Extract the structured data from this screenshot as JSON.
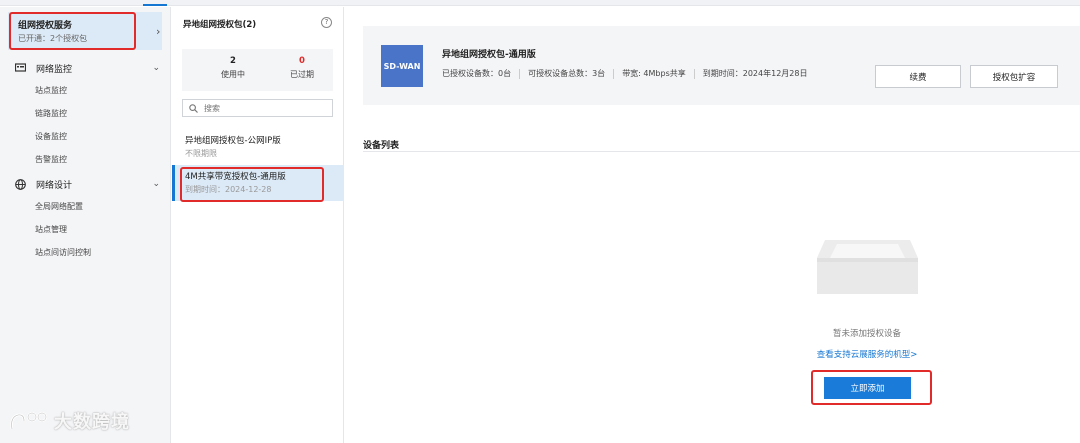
{
  "left_nav": {
    "service": {
      "title": "组网授权服务",
      "subtitle": "已开通：2个授权包",
      "arrow": "›"
    },
    "groups": [
      {
        "label": "网络监控",
        "icon": "monitor-icon",
        "items": [
          "站点监控",
          "链路监控",
          "设备监控",
          "告警监控"
        ]
      },
      {
        "label": "网络设计",
        "icon": "globe-icon",
        "items": [
          "全局网络配置",
          "站点管理",
          "站点间访问控制"
        ]
      }
    ]
  },
  "middle": {
    "title": "异地组网授权包(2)",
    "stats": [
      {
        "value": "2",
        "label": "使用中",
        "color": "#222222"
      },
      {
        "value": "0",
        "label": "已过期",
        "color": "#e12a2a"
      }
    ],
    "search": {
      "placeholder": "搜索"
    },
    "packages": [
      {
        "name": "异地组网授权包-公网IP版",
        "sub": "不限期限",
        "active": false
      },
      {
        "name": "4M共享带宽授权包-通用版",
        "sub": "到期时间：2024-12-28",
        "active": true
      }
    ]
  },
  "main": {
    "logo_text": "SD-WAN",
    "package_title": "异地组网授权包-通用版",
    "details": [
      "已授权设备数：0台",
      "可授权设备总数：3台",
      "带宽: 4Mbps共享",
      "到期时间：2024年12月28日"
    ],
    "renew_button": "续费",
    "expand_button": "授权包扩容",
    "section_title": "设备列表",
    "empty_text": "暂未添加授权设备",
    "empty_link": "查看支持云展服务的机型>",
    "add_button": "立即添加"
  },
  "watermark": "大数跨境",
  "colors": {
    "accent": "#1677d2",
    "highlight": "#e12a2a",
    "selected_bg": "#dce9f6"
  }
}
